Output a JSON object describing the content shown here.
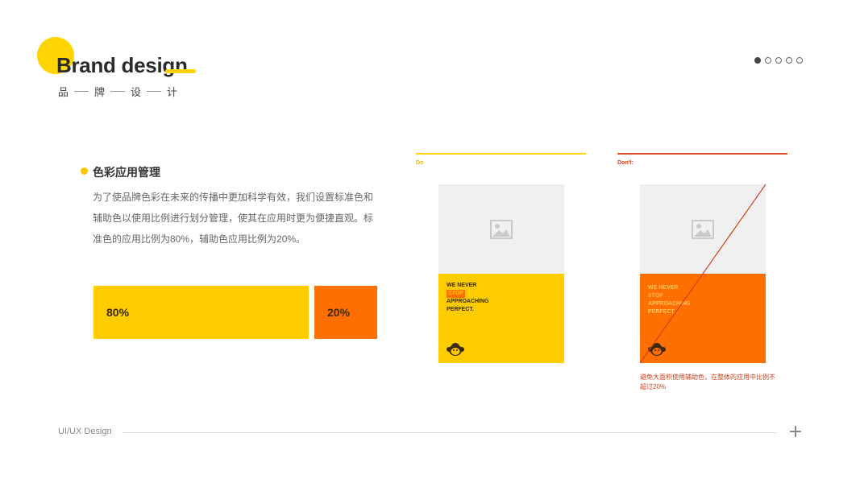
{
  "header": {
    "title": "Brand design",
    "subtitle_chars": [
      "品",
      "牌",
      "设",
      "计"
    ]
  },
  "pager": {
    "total": 5,
    "active_index": 0
  },
  "section": {
    "title": "色彩应用管理",
    "description": "为了使品牌色彩在未来的传播中更加科学有效，我们设置标准色和辅助色以使用比例进行划分管理，使其在应用时更为便捷直观。标准色的应用比例为80%，辅助色应用比例为20%。"
  },
  "ratio": {
    "primary": {
      "label": "80%",
      "value": 80,
      "color": "#FFCC00"
    },
    "secondary": {
      "label": "20%",
      "value": 20,
      "color": "#FF6F00"
    }
  },
  "do_panel": {
    "tag": "Do",
    "slogan": [
      "WE NEVER",
      "STOP",
      "APPROACHING",
      "PERFECT."
    ]
  },
  "dont_panel": {
    "tag": "Don't:",
    "slogan": [
      "WE NEVER",
      "STOP",
      "APPROACHING",
      "PERFECT."
    ],
    "note": "避免大面积使用辅助色，在整体的应用中比例不超过20%"
  },
  "footer": {
    "label": "UI/UX Design"
  },
  "icons": {
    "image_placeholder": "image-placeholder-icon",
    "mascot": "monkey-mascot-icon",
    "add": "plus-icon"
  }
}
